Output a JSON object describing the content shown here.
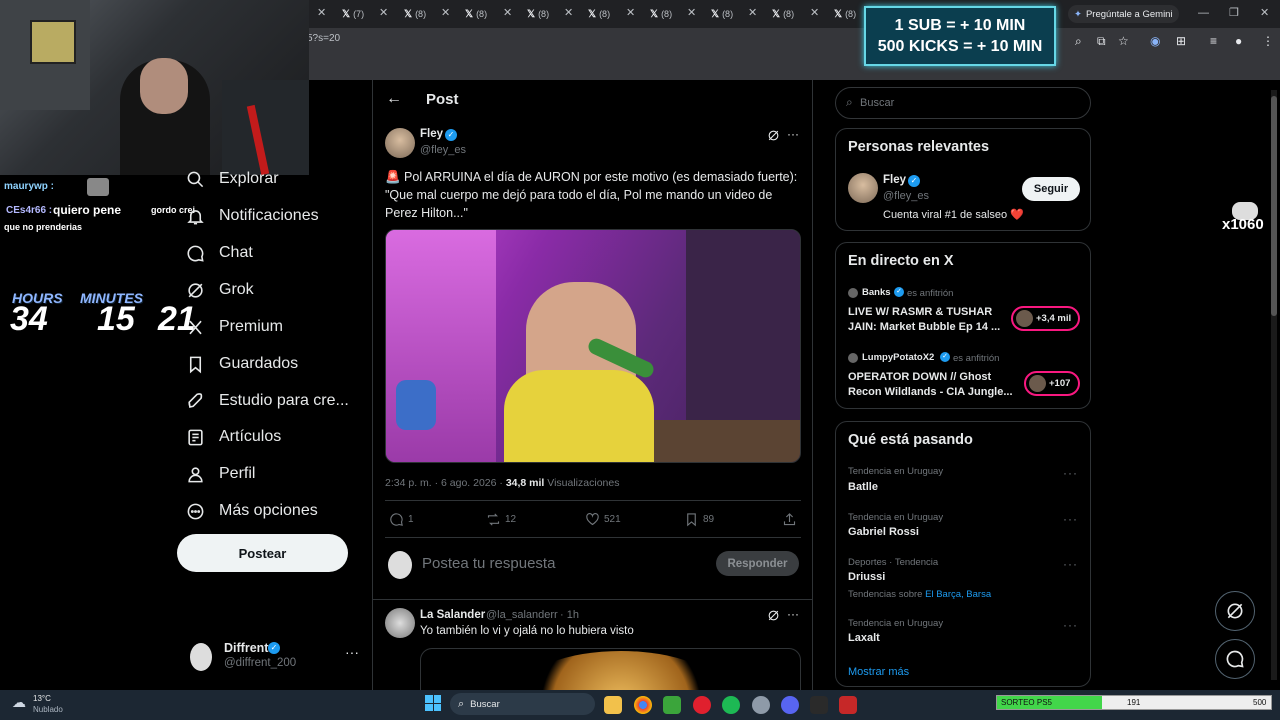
{
  "browser": {
    "tabs": [
      "(7)",
      "(8)",
      "(8)",
      "(8)",
      "(8)",
      "(8)",
      "(8)",
      "(8)",
      "(8)"
    ],
    "url_fragment": "5?s=20",
    "gemini_label": "Pregúntale a Gemini"
  },
  "stream": {
    "subs_banner": {
      "line1": "1 SUB = + 10 MIN",
      "line2": "500 KICKS = + 10 MIN"
    },
    "chat": [
      {
        "user": "maurywp :",
        "text": ""
      },
      {
        "user": "CEs4r66 :",
        "text": "quiero pene"
      },
      {
        "user": "gordo crei",
        "text": ""
      },
      {
        "user": "",
        "text": "que no prenderias"
      }
    ],
    "timer": {
      "hours_label": "HOURS",
      "minutes_label": "MINUTES",
      "hours": "34",
      "minutes": "15",
      "seconds": "21"
    },
    "viewer_badge": "x1060"
  },
  "nav": {
    "items": [
      {
        "label": "Explorar",
        "icon": "search-icon"
      },
      {
        "label": "Notificaciones",
        "icon": "bell-icon"
      },
      {
        "label": "Chat",
        "icon": "chat-icon"
      },
      {
        "label": "Grok",
        "icon": "grok-icon"
      },
      {
        "label": "Premium",
        "icon": "x-premium-icon"
      },
      {
        "label": "Guardados",
        "icon": "bookmark-icon"
      },
      {
        "label": "Estudio para cre...",
        "icon": "rocket-icon"
      },
      {
        "label": "Artículos",
        "icon": "article-icon"
      },
      {
        "label": "Perfil",
        "icon": "profile-icon"
      },
      {
        "label": "Más opciones",
        "icon": "more-icon"
      }
    ],
    "post_button": "Postear",
    "account": {
      "name": "Diffrent",
      "handle": "@diffrent_200"
    }
  },
  "post": {
    "header": "Post",
    "author": {
      "name": "Fley",
      "handle": "@fley_es"
    },
    "text_line1": "🚨 Pol ARRUINA el día de AURON por este motivo (es demasiado fuerte):",
    "text_line2": "\"Que mal cuerpo me dejó para todo el día, Pol me mando un video de",
    "text_line3": "Perez Hilton...\"",
    "meta_time": "2:34 p. m. · 6 ago. 2026 · ",
    "meta_views": "34,8 mil",
    "meta_views_label": " Visualizaciones",
    "actions": {
      "replies": "1",
      "reposts": "12",
      "likes": "521",
      "bookmarks": "89"
    },
    "reply_placeholder": "Postea tu respuesta",
    "reply_button": "Responder"
  },
  "reply": {
    "name": "La Salander",
    "handle": "@la_salanderr",
    "time": "· 1h",
    "text": "Yo también lo vi y ojalá no lo hubiera visto"
  },
  "sidebar": {
    "search_placeholder": "Buscar",
    "relevant": {
      "title": "Personas relevantes",
      "name": "Fley",
      "handle": "@fley_es",
      "bio": "Cuenta viral #1 de salseo ❤️",
      "follow": "Seguir"
    },
    "live": {
      "title": "En directo en X",
      "items": [
        {
          "host": "Banks",
          "role": "es anfitrión",
          "title1": "LIVE W/ RASMR & TUSHAR",
          "title2": "JAIN: Market Bubble Ep 14 ...",
          "count": "+3,4 mil"
        },
        {
          "host": "LumpyPotatoX2",
          "role": "es anfitrión",
          "title1": "OPERATOR DOWN // Ghost",
          "title2": "Recon Wildlands - CIA Jungle...",
          "count": "+107"
        }
      ]
    },
    "trending": {
      "title": "Qué está pasando",
      "items": [
        {
          "context": "Tendencia en Uruguay",
          "name": "Batlle",
          "extra": ""
        },
        {
          "context": "Tendencia en Uruguay",
          "name": "Gabriel Rossi",
          "extra": ""
        },
        {
          "context": "Deportes · Tendencia",
          "name": "Driussi",
          "extra_prefix": "Tendencias sobre ",
          "extra": "El Barça, Barsa"
        },
        {
          "context": "Tendencia en Uruguay",
          "name": "Laxalt",
          "extra": ""
        }
      ],
      "show_more": "Mostrar más"
    }
  },
  "taskbar": {
    "weather_temp": "13°C",
    "weather_desc": "Nublado",
    "search": "Buscar",
    "sorteo_label": "SORTEO PS5",
    "sorteo_current": "191",
    "sorteo_goal": "500",
    "sorteo_progress": 0.382
  },
  "colors": {
    "accent": "#1d9bf0",
    "background": "#000000",
    "follow_bg": "#eff3f4",
    "live_ring": "#f91880"
  }
}
